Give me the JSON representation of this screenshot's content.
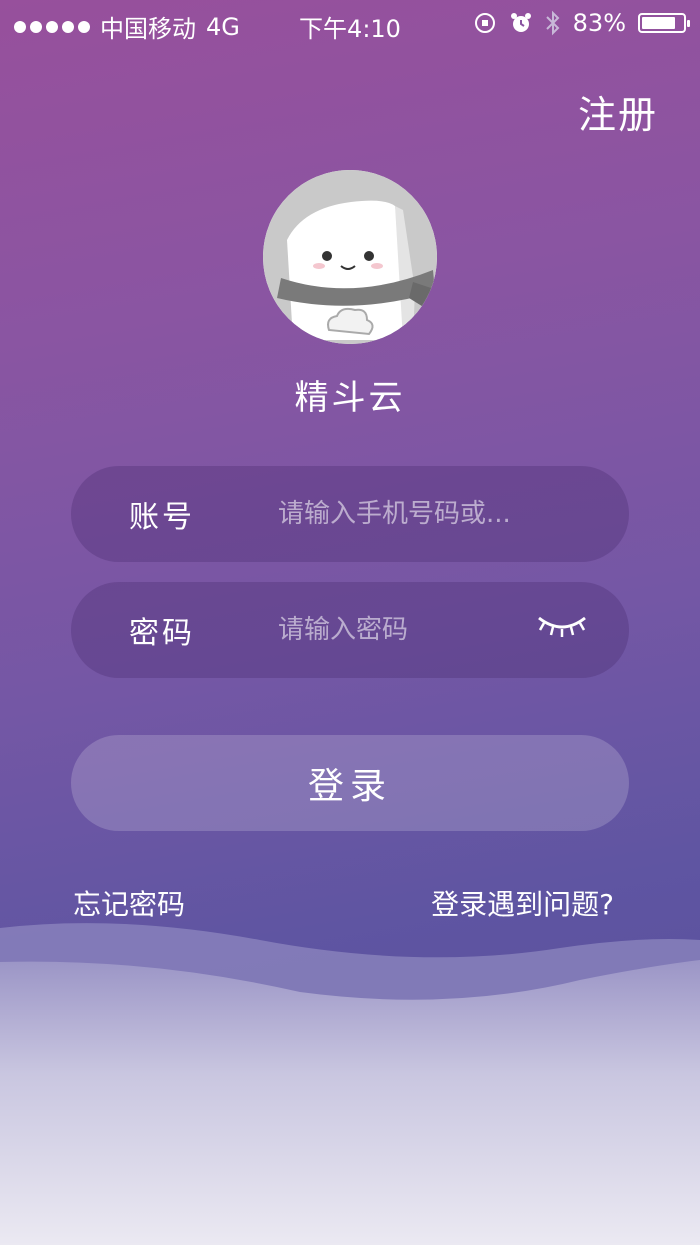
{
  "status_bar": {
    "carrier": "中国移动",
    "network": "4G",
    "time": "下午4:10",
    "battery": "83%"
  },
  "header": {
    "register_label": "注册"
  },
  "profile": {
    "app_name": "精斗云"
  },
  "form": {
    "account": {
      "label": "账号",
      "placeholder": "请输入手机号码或..."
    },
    "password": {
      "label": "密码",
      "placeholder": "请输入密码"
    },
    "login_label": "登录"
  },
  "links": {
    "forgot_password": "忘记密码",
    "login_problem": "登录遇到问题?"
  }
}
